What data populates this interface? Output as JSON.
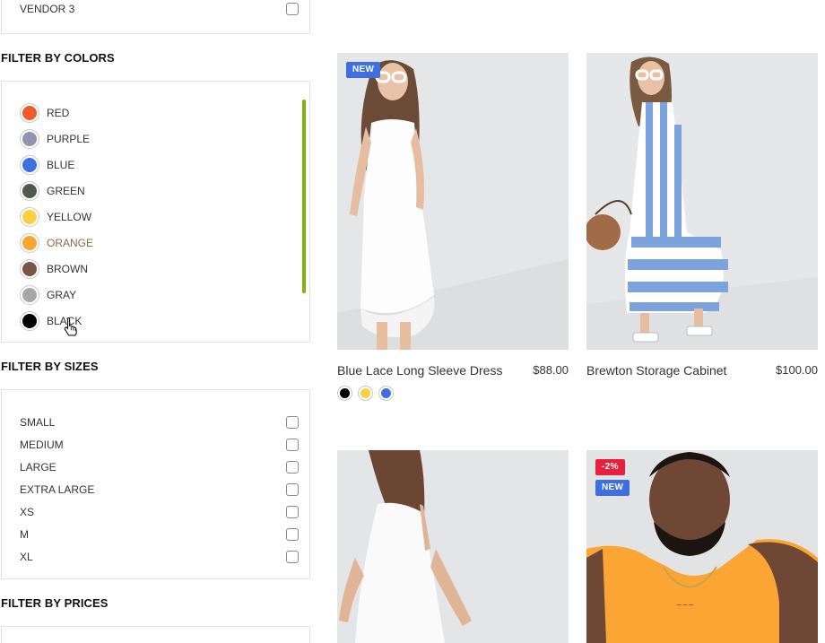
{
  "vendors": {
    "items": [
      {
        "label": "VENDOR 3"
      }
    ]
  },
  "colors_filter": {
    "heading": "FILTER BY COLORS",
    "items": [
      {
        "label": "RED",
        "color": "#f05a2c"
      },
      {
        "label": "PURPLE",
        "color": "#9393ad"
      },
      {
        "label": "BLUE",
        "color": "#3f6fe3"
      },
      {
        "label": "GREEN",
        "color": "#4f5a4c"
      },
      {
        "label": "YELLOW",
        "color": "#fdd044"
      },
      {
        "label": "ORANGE",
        "color": "#fca52e"
      },
      {
        "label": "BROWN",
        "color": "#7a5545"
      },
      {
        "label": "GRAY",
        "color": "#a7a8a5"
      },
      {
        "label": "BLACK",
        "color": "#000000"
      }
    ],
    "scrollbar_color": "#7cb40f"
  },
  "sizes_filter": {
    "heading": "FILTER BY SIZES",
    "items": [
      {
        "label": "SMALL"
      },
      {
        "label": "MEDIUM"
      },
      {
        "label": "LARGE"
      },
      {
        "label": "EXTRA LARGE"
      },
      {
        "label": "XS"
      },
      {
        "label": "M"
      },
      {
        "label": "XL"
      }
    ]
  },
  "prices_filter": {
    "heading": "FILTER BY PRICES"
  },
  "products": [
    {
      "title": "Blue Lace Long Sleeve Dress",
      "price": "$88.00",
      "badges": [
        "NEW"
      ],
      "swatches": [
        "#000000",
        "#fdd044",
        "#3f6fe3"
      ]
    },
    {
      "title": "Brewton Storage Cabinet",
      "price": "$100.00",
      "badges": [],
      "swatches": []
    },
    {
      "title": "",
      "price": "",
      "badges": [],
      "swatches": []
    },
    {
      "title": "",
      "price": "",
      "badges": [
        "-2%",
        "NEW"
      ],
      "swatches": []
    }
  ],
  "badge_colors": {
    "new": "#3d6fe0",
    "sale": "#e8203e"
  }
}
